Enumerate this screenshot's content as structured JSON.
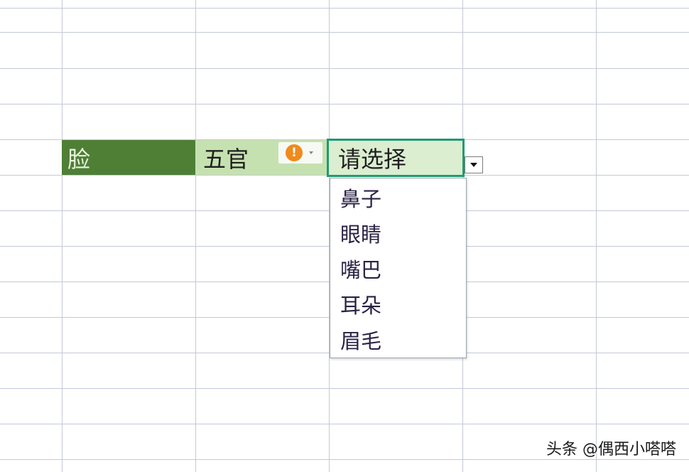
{
  "sheet": {
    "cell_face": "脸",
    "cell_features": "五官",
    "warning_icon": "warning-circle",
    "warning_glyph": "!",
    "select_placeholder": "请选择",
    "options": [
      "鼻子",
      "眼睛",
      "嘴巴",
      "耳朵",
      "眉毛"
    ]
  },
  "watermark": "头条 @偶西小嗒嗒",
  "colors": {
    "face_fill": "#4e7f35",
    "features_fill": "#c6e1b0",
    "selection_border": "#1e9a74",
    "warning": "#f08a1c",
    "gridline": "#c3c9d6"
  }
}
